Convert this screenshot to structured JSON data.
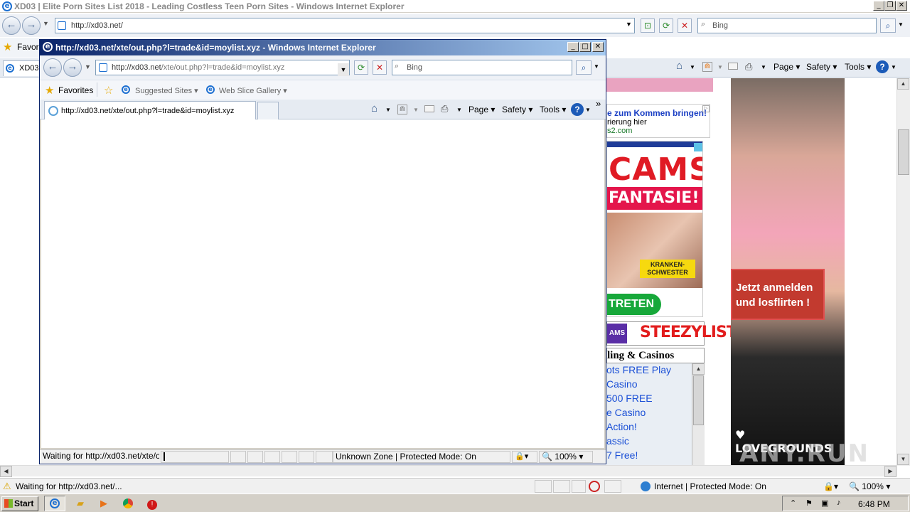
{
  "main_window": {
    "title": "XD03 | Elite Porn Sites List 2018 - Leading Costless Teen Porn Sites - Windows Internet Explorer",
    "address": "http://xd03.net/",
    "search_placeholder": "Bing",
    "favorites_label": "Favori",
    "tab_label": "XD03",
    "commands": {
      "page": "Page",
      "safety": "Safety",
      "tools": "Tools"
    },
    "status_text": "Waiting for http://xd03.net/...",
    "zone_text": "Internet | Protected Mode: On",
    "zoom": "100%"
  },
  "popup_window": {
    "title": "http://xd03.net/xte/out.php?l=trade&id=moylist.xyz - Windows Internet Explorer",
    "address_domain": "http://xd03.net",
    "address_path": "/xte/out.php?l=trade&id=moylist.xyz",
    "search_placeholder": "Bing",
    "favorites_label": "Favorites",
    "suggested_sites": "Suggested Sites",
    "web_slice_gallery": "Web Slice Gallery",
    "tab_label": "http://xd03.net/xte/out.php?l=trade&id=moylist.xyz",
    "commands": {
      "page": "Page",
      "safety": "Safety",
      "tools": "Tools"
    },
    "status_text": "Waiting for http://xd03.net/xte/o",
    "zone_text": "Unknown Zone | Protected Mode: On",
    "zoom": "100%"
  },
  "background_page": {
    "ad_text_line1": "e zum Kommen bringen!",
    "ad_text_line2": "rierung hier",
    "ad_text_line3": "s2.com",
    "cams_title": "CAMS",
    "cams_subtitle": "FANTASIE!",
    "cams_badge": "KRANKEN-\nSCHWESTER",
    "cams_button": "TRETEN",
    "steezy_left": "AMS",
    "steezy_brand": "STEEZYLIST",
    "casino_heading": "ling & Casinos",
    "casino_links": [
      "ots FREE Play",
      "Casino",
      "500 FREE",
      "e Casino",
      "Action!",
      "assic",
      "7 Free!"
    ],
    "lady_cta": "Jetzt anmelden und losflirten !",
    "lady_brand": "LOVEGROUNDS"
  },
  "taskbar": {
    "start_label": "Start",
    "clock": "6:48 PM"
  },
  "watermark": "ANY.RUN"
}
